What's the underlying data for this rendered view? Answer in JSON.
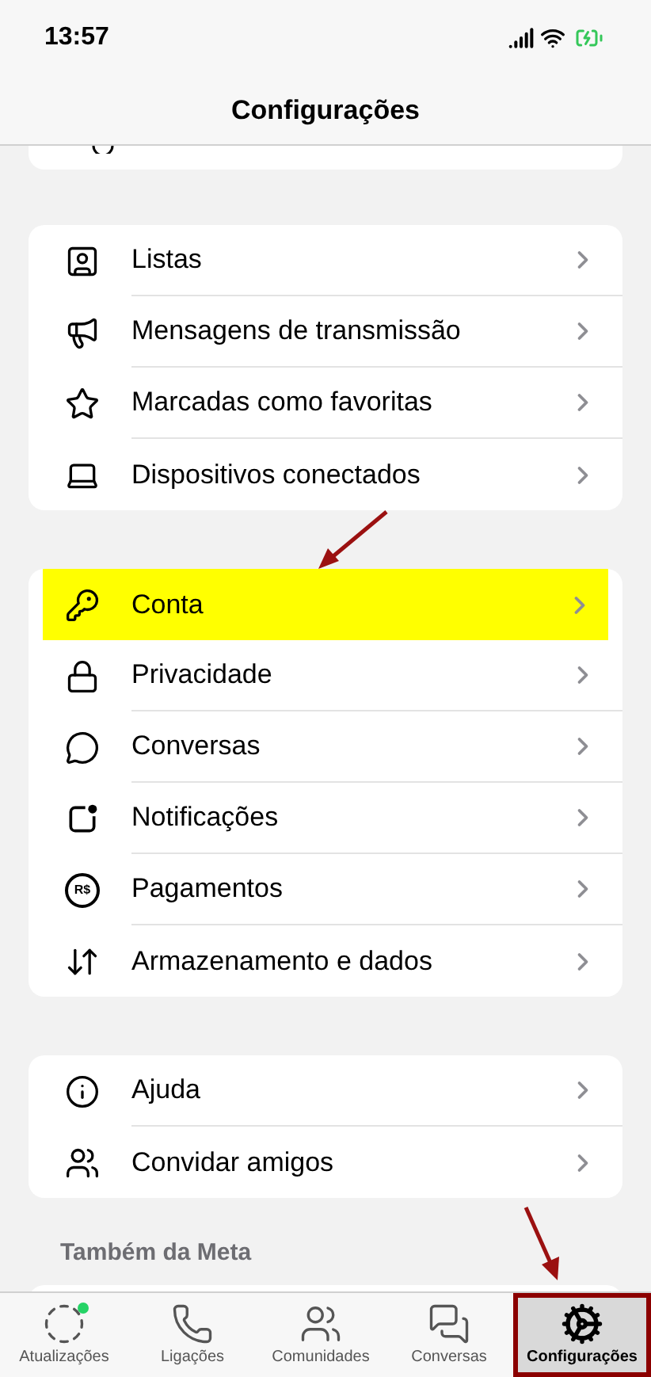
{
  "status_bar": {
    "time": "13:57"
  },
  "header": {
    "title": "Configurações"
  },
  "sections": [
    {
      "items": [
        {
          "label": "Listas",
          "highlighted": false
        },
        {
          "label": "Mensagens de transmissão",
          "highlighted": false
        },
        {
          "label": "Marcadas como favoritas",
          "highlighted": false
        },
        {
          "label": "Dispositivos conectados",
          "highlighted": false
        }
      ]
    },
    {
      "items": [
        {
          "label": "Conta",
          "highlighted": true
        },
        {
          "label": "Privacidade",
          "highlighted": false
        },
        {
          "label": "Conversas",
          "highlighted": false
        },
        {
          "label": "Notificações",
          "highlighted": false
        },
        {
          "label": "Pagamentos",
          "highlighted": false,
          "icon_text": "R$"
        },
        {
          "label": "Armazenamento e dados",
          "highlighted": false
        }
      ]
    },
    {
      "items": [
        {
          "label": "Ajuda",
          "highlighted": false
        },
        {
          "label": "Convidar amigos",
          "highlighted": false
        }
      ]
    }
  ],
  "meta_heading": "Também da Meta",
  "tabs": [
    {
      "label": "Atualizações",
      "selected": false,
      "unread": true
    },
    {
      "label": "Ligações",
      "selected": false,
      "unread": false
    },
    {
      "label": "Comunidades",
      "selected": false,
      "unread": false
    },
    {
      "label": "Conversas",
      "selected": false,
      "unread": false
    },
    {
      "label": "Configurações",
      "selected": true,
      "unread": false
    }
  ]
}
